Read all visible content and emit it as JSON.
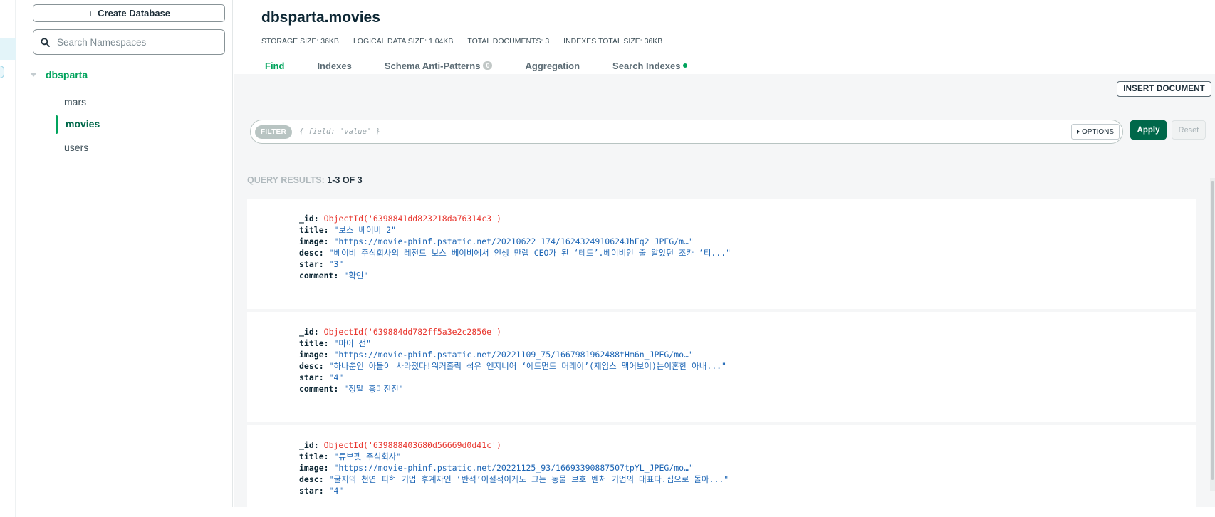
{
  "sidebar": {
    "create_label": "Create Database",
    "create_icon": "plus-icon",
    "search_placeholder": "Search Namespaces",
    "database": "dbsparta",
    "collections": [
      "mars",
      "movies",
      "users"
    ],
    "active_collection": "movies"
  },
  "header": {
    "title": "dbsparta.movies",
    "stats": [
      {
        "label": "STORAGE SIZE:",
        "value": "36KB"
      },
      {
        "label": "LOGICAL DATA SIZE:",
        "value": "1.04KB"
      },
      {
        "label": "TOTAL DOCUMENTS:",
        "value": "3"
      },
      {
        "label": "INDEXES TOTAL SIZE:",
        "value": "36KB"
      }
    ],
    "tabs": [
      {
        "label": "Find",
        "active": true
      },
      {
        "label": "Indexes"
      },
      {
        "label": "Schema Anti-Patterns",
        "badge": "0"
      },
      {
        "label": "Aggregation"
      },
      {
        "label": "Search Indexes",
        "dot": true
      }
    ]
  },
  "toolbar": {
    "insert_label": "INSERT DOCUMENT",
    "filter_pill": "FILTER",
    "filter_placeholder": "{ field: 'value' }",
    "options_label": "OPTIONS",
    "apply_label": "Apply",
    "reset_label": "Reset"
  },
  "results": {
    "label": "QUERY RESULTS:",
    "range": "1-3 OF 3",
    "documents": [
      {
        "_id": "ObjectId('6398841dd823218da76314c3')",
        "title": "\"보스 베이비 2\"",
        "image": "\"https://movie-phinf.pstatic.net/20210622_174/1624324910624JhEq2_JPEG/m…\"",
        "desc": "\"베이비 주식회사의 레전드 보스 베이비에서 인생 만렙 CEO가 된 ‘테드’.베이비인 줄 알았던 조카 ‘티...\"",
        "star": "\"3\"",
        "comment": "\"확인\""
      },
      {
        "_id": "ObjectId('639884dd782ff5a3e2c2856e')",
        "title": "\"마이 선\"",
        "image": "\"https://movie-phinf.pstatic.net/20221109_75/1667981962488tHm6n_JPEG/mo…\"",
        "desc": "\"하나뿐인 아들이 사라졌다!워커홀릭 석유 엔지니어 ‘에드먼드 머레이’(제임스 맥어보이)는이혼한 아내...\"",
        "star": "\"4\"",
        "comment": "\"정말 흥미진진\""
      },
      {
        "_id": "ObjectId('639888403680d56669d0d41c')",
        "title": "\"튜브펫 주식회사\"",
        "image": "\"https://movie-phinf.pstatic.net/20221125_93/16693390887507tpYL_JPEG/mo…\"",
        "desc": "\"굴지의 천연 피혁 기업 후계자인 ‘반석’이절적이게도 그는 동물 보호 벤처 기업의 대표다.집으로 돌아...\"",
        "star": "\"4\""
      }
    ]
  }
}
